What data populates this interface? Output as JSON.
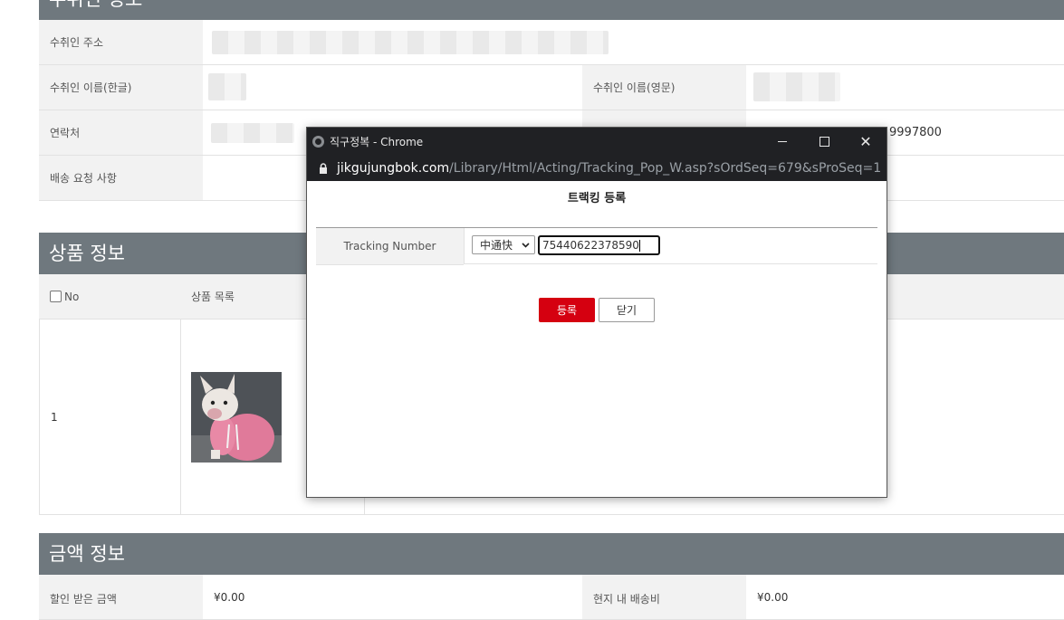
{
  "sections": {
    "recipient_title": "수취인 정보",
    "product_title": "상품 정보",
    "amount_title": "금액 정보"
  },
  "recipient": {
    "address_label": "수취인 주소",
    "name_kr_label": "수취인 이름(한글)",
    "name_en_label": "수취인 이름(영문)",
    "contact_label": "연락처",
    "contact_partial": "9997800",
    "request_label": "배송 요청 사항"
  },
  "product": {
    "header_no": "No",
    "header_list": "상품 목록",
    "row_no": "1"
  },
  "amount": {
    "discount_label": "할인 받은 금액",
    "discount_value": "¥0.00",
    "local_ship_label": "현지 내 배송비",
    "local_ship_value": "¥0.00"
  },
  "popup": {
    "window_title": "직구정복 - Chrome",
    "url_domain": "jikgujungbok.com",
    "url_path": "/Library/Html/Acting/Tracking_Pop_W.asp?sOrdSeq=679&sProSeq=1",
    "heading": "트랙킹 등록",
    "tracking_label": "Tracking Number",
    "carrier_selected": "中通快",
    "tracking_value": "75440622378590",
    "register_button": "등록",
    "close_button": "닫기"
  },
  "icons": {
    "minimize": "minimize-icon",
    "maximize": "maximize-icon",
    "close": "close-icon",
    "lock": "lock-icon",
    "globe": "globe-icon"
  }
}
